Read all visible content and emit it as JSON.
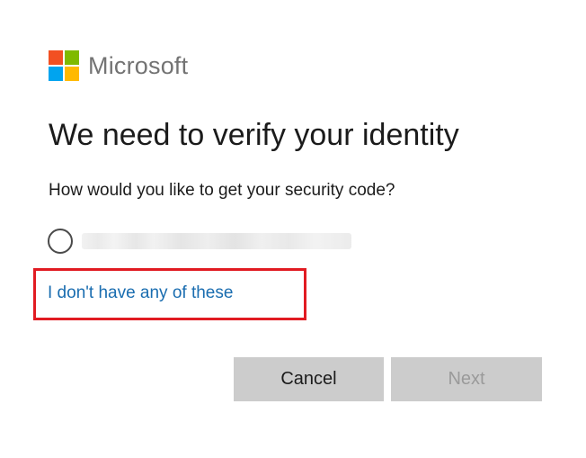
{
  "brand": {
    "name": "Microsoft",
    "logo_colors": [
      "#f25022",
      "#7fba00",
      "#00a4ef",
      "#ffb900"
    ]
  },
  "title": "We need to verify your identity",
  "subtitle": "How would you like to get your security code?",
  "options": [
    {
      "label": "",
      "selected": false,
      "obscured": true
    }
  ],
  "no_option_link": "I don't have any of these",
  "buttons": {
    "cancel": "Cancel",
    "next": "Next",
    "next_disabled": true
  },
  "colors": {
    "link": "#1a6db0",
    "highlight_border": "#e11b22",
    "button_bg": "#cccccc"
  }
}
